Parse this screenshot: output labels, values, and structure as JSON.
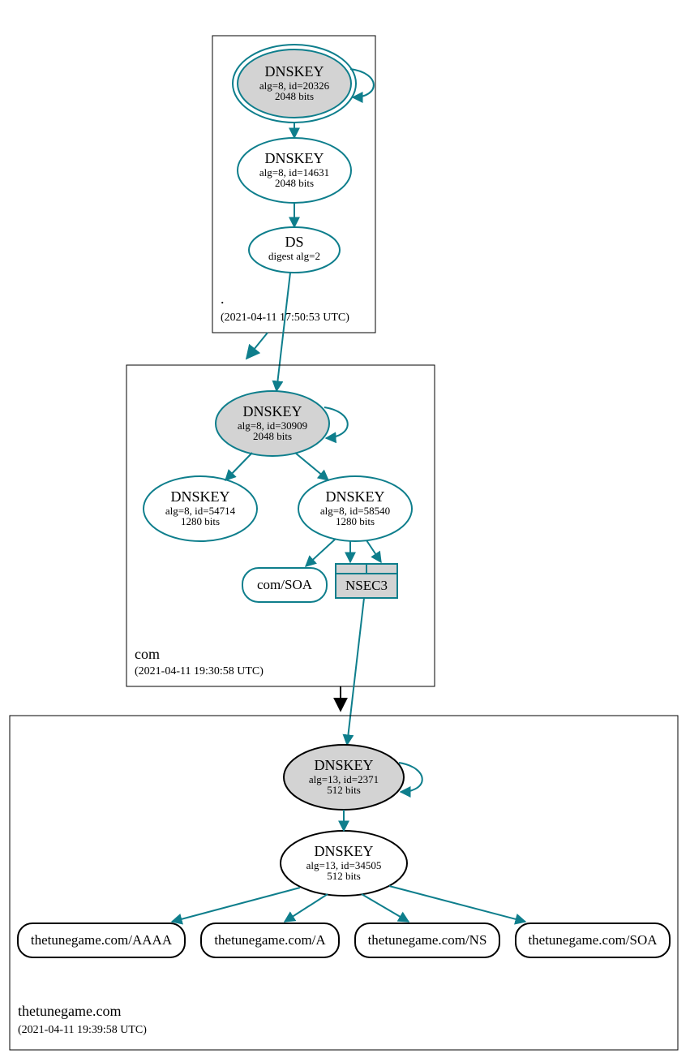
{
  "colors": {
    "teal": "#0e7e8c",
    "grey": "#d3d3d3"
  },
  "zones": {
    "root": {
      "label": ".",
      "timestamp": "(2021-04-11 17:50:53 UTC)",
      "nodes": {
        "ksk": {
          "title": "DNSKEY",
          "line2": "alg=8, id=20326",
          "line3": "2048 bits"
        },
        "zsk": {
          "title": "DNSKEY",
          "line2": "alg=8, id=14631",
          "line3": "2048 bits"
        },
        "ds": {
          "title": "DS",
          "line2": "digest alg=2"
        }
      }
    },
    "com": {
      "label": "com",
      "timestamp": "(2021-04-11 19:30:58 UTC)",
      "nodes": {
        "ksk": {
          "title": "DNSKEY",
          "line2": "alg=8, id=30909",
          "line3": "2048 bits"
        },
        "zsk1": {
          "title": "DNSKEY",
          "line2": "alg=8, id=54714",
          "line3": "1280 bits"
        },
        "zsk2": {
          "title": "DNSKEY",
          "line2": "alg=8, id=58540",
          "line3": "1280 bits"
        },
        "soa": {
          "label": "com/SOA"
        },
        "nsec3": {
          "label": "NSEC3"
        }
      }
    },
    "leaf": {
      "label": "thetunegame.com",
      "timestamp": "(2021-04-11 19:39:58 UTC)",
      "nodes": {
        "ksk": {
          "title": "DNSKEY",
          "line2": "alg=13, id=2371",
          "line3": "512 bits"
        },
        "zsk": {
          "title": "DNSKEY",
          "line2": "alg=13, id=34505",
          "line3": "512 bits"
        },
        "rr_aaaa": {
          "label": "thetunegame.com/AAAA"
        },
        "rr_a": {
          "label": "thetunegame.com/A"
        },
        "rr_ns": {
          "label": "thetunegame.com/NS"
        },
        "rr_soa": {
          "label": "thetunegame.com/SOA"
        }
      }
    }
  }
}
